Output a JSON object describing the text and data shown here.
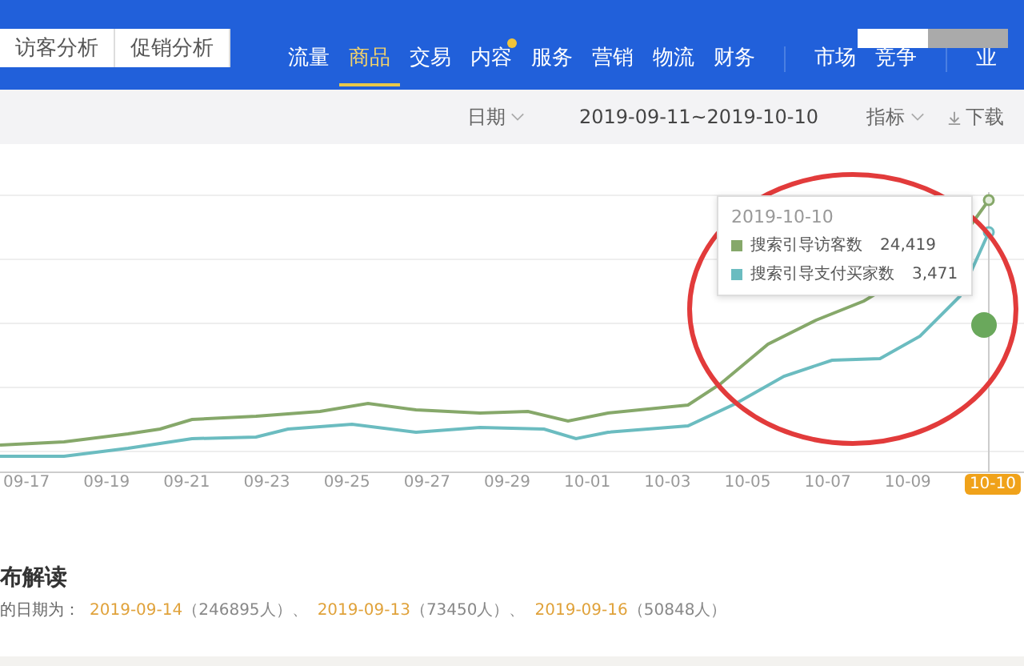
{
  "subtabs": [
    {
      "label": "访客分析"
    },
    {
      "label": "促销分析"
    }
  ],
  "nav": [
    {
      "label": "流量",
      "selected": false,
      "dot": false
    },
    {
      "label": "商品",
      "selected": true,
      "dot": false
    },
    {
      "label": "交易",
      "selected": false,
      "dot": false
    },
    {
      "label": "内容",
      "selected": false,
      "dot": true
    },
    {
      "label": "服务",
      "selected": false,
      "dot": false
    },
    {
      "label": "营销",
      "selected": false,
      "dot": false
    },
    {
      "label": "物流",
      "selected": false,
      "dot": false
    },
    {
      "label": "财务",
      "selected": false,
      "dot": false
    }
  ],
  "nav_right": [
    {
      "label": "市场",
      "selected": false
    },
    {
      "label": "竞争",
      "selected": false
    }
  ],
  "nav_cut": "业",
  "filters": {
    "date_label": "日期",
    "date_range": "2019-09-11~2019-10-10",
    "metric_label": "指标",
    "download": "下载"
  },
  "chart": {
    "x_labels": [
      "09-17",
      "09-19",
      "09-21",
      "09-23",
      "09-25",
      "09-27",
      "09-29",
      "10-01",
      "10-03",
      "10-05",
      "10-07",
      "10-09",
      "10-10"
    ],
    "tooltip": {
      "date": "2019-10-10",
      "items": [
        {
          "name": "搜索引导访客数",
          "value": "24,419",
          "color": "#86a86a"
        },
        {
          "name": "搜索引导支付买家数",
          "value": "3,471",
          "color": "#6bbcc0"
        }
      ]
    }
  },
  "section": {
    "title": "布解读",
    "intro": "的日期为：",
    "dates": [
      {
        "date": "2019-09-14",
        "count": "（246895人）、"
      },
      {
        "date": "2019-09-13",
        "count": "（73450人）、"
      },
      {
        "date": "2019-09-16",
        "count": "（50848人）"
      }
    ]
  }
}
